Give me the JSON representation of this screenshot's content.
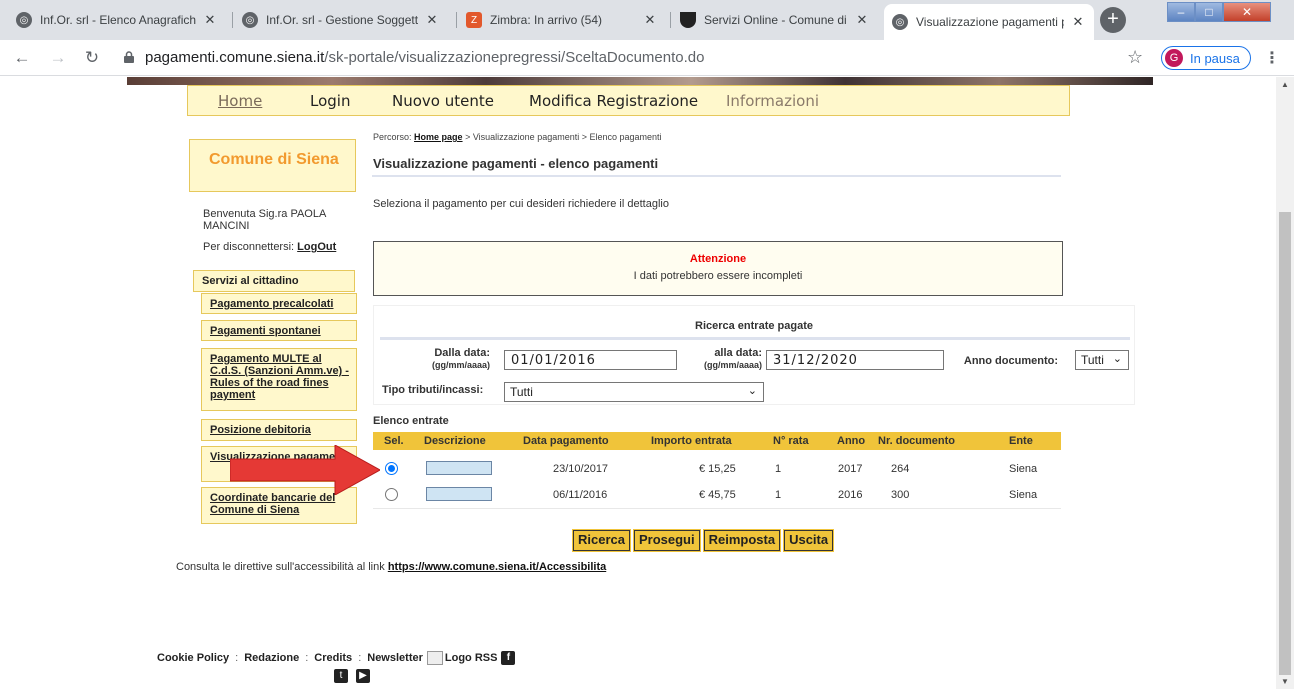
{
  "browser": {
    "tabs": [
      {
        "title": "Inf.Or. srl - Elenco Anagrafich",
        "icon": "globe-icon"
      },
      {
        "title": "Inf.Or. srl - Gestione Soggetti",
        "icon": "globe-icon"
      },
      {
        "title": "Zimbra: In arrivo (54)",
        "icon": "zimbra-icon"
      },
      {
        "title": "Servizi Online - Comune di S",
        "icon": "comune-icon"
      },
      {
        "title": "Visualizzazione pagamenti p",
        "icon": "globe-icon"
      }
    ],
    "url_host": "pagamenti.comune.siena.it",
    "url_path": "/sk-portale/visualizzazionepregressi/SceltaDocumento.do",
    "profile_initial": "G",
    "profile_label": "In pausa"
  },
  "topnav": {
    "home": "Home",
    "login": "Login",
    "nuovo_utente": "Nuovo utente",
    "modifica": "Modifica Registrazione",
    "informazioni": "Informazioni"
  },
  "sidebar": {
    "brand": "Comune di Siena",
    "welcome": "Benvenuta Sig.ra PAOLA MANCINI",
    "logout_prefix": "Per disconnettersi:",
    "logout_link": "LogOut",
    "services_title": "Servizi al cittadino",
    "services": [
      "Pagamento precalcolati",
      "Pagamenti spontanei",
      "Pagamento MULTE al C.d.S. (Sanzioni Amm.ve) - Rules of the road fines payment",
      "Posizione debitoria",
      "Visualizzazione pagamenti",
      "Coordinate bancarie del Comune di Siena"
    ]
  },
  "main": {
    "breadcrumb_prefix": "Percorso:",
    "breadcrumb_home": "Home page",
    "breadcrumb_rest": "> Visualizzazione pagamenti > Elenco pagamenti",
    "title": "Visualizzazione pagamenti - elenco pagamenti",
    "instruction": "Seleziona il pagamento per cui desideri richiedere il dettaglio",
    "alert_title": "Attenzione",
    "alert_message": "I dati potrebbero essere incompleti"
  },
  "search": {
    "title": "Ricerca entrate pagate",
    "from_label": "Dalla data:",
    "from_hint": "(gg/mm/aaaa)",
    "from_value": "01/01/2016",
    "to_label": "alla data:",
    "to_hint": "(gg/mm/aaaa)",
    "to_value": "31/12/2020",
    "anno_label": "Anno documento:",
    "anno_value": "Tutti",
    "tipo_label": "Tipo tributi/incassi:",
    "tipo_value": "Tutti"
  },
  "list": {
    "label": "Elenco entrate",
    "columns": [
      "Sel.",
      "Descrizione",
      "Data pagamento",
      "Importo entrata",
      "N° rata",
      "Anno",
      "Nr. documento",
      "Ente"
    ],
    "rows": [
      {
        "selected": true,
        "data": "23/10/2017",
        "importo": "€ 15,25",
        "rata": "1",
        "anno": "2017",
        "documento": "264",
        "ente": "Siena"
      },
      {
        "selected": false,
        "data": "06/11/2016",
        "importo": "€ 45,75",
        "rata": "1",
        "anno": "2016",
        "documento": "300",
        "ente": "Siena"
      }
    ]
  },
  "buttons": {
    "ricerca": "Ricerca",
    "prosegui": "Prosegui",
    "reimposta": "Reimposta",
    "uscita": "Uscita"
  },
  "accessibility": {
    "prefix": "Consulta le direttive sull'accessibilità al link",
    "link": "https://www.comune.siena.it/Accessibilita"
  },
  "footer": {
    "cookie": "Cookie Policy",
    "redazione": "Redazione",
    "credits": "Credits",
    "newsletter": "Newsletter",
    "rss_alt": "Logo RSS"
  },
  "colors": {
    "accent_yellow": "#f0c43a",
    "brand_orange": "#f29a2e",
    "alert_red": "#ee0000",
    "annotation_arrow": "#e53935"
  }
}
